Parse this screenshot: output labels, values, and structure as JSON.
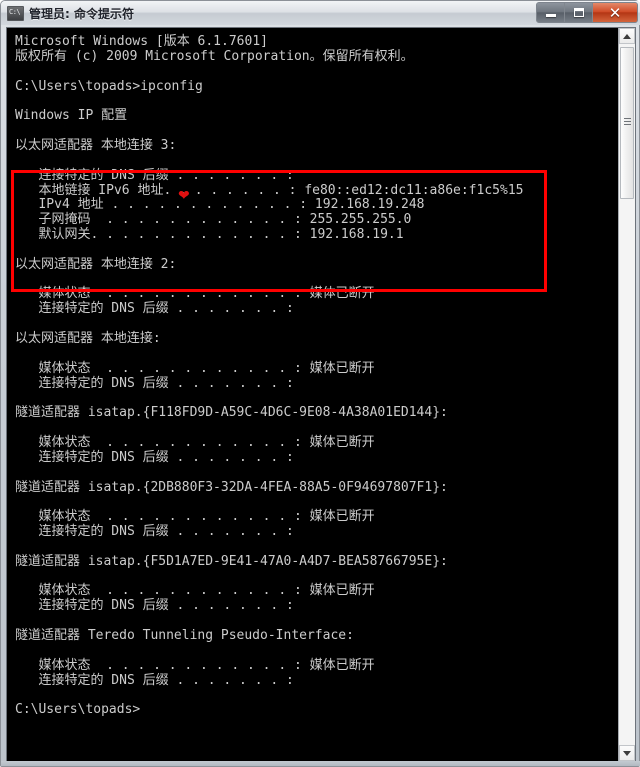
{
  "window": {
    "title": "管理员: 命令提示符",
    "icon": "cmd-console-icon",
    "buttons": {
      "minimize": "最小化",
      "maximize": "最大化",
      "close": "关闭"
    }
  },
  "colors": {
    "console_background": "#000000",
    "console_text": "#cccccc",
    "annotation_red": "#ff0000",
    "close_button": "#cf4a25",
    "titlebar": "#dde1e6"
  },
  "console": {
    "lines": [
      {
        "text": "Microsoft Windows [版本 6.1.7601]"
      },
      {
        "text": "版权所有 (c) 2009 Microsoft Corporation。保留所有权利。"
      },
      {
        "text": ""
      },
      {
        "text": "C:\\Users\\topads>ipconfig"
      },
      {
        "text": ""
      },
      {
        "text": "Windows IP 配置"
      },
      {
        "text": ""
      },
      {
        "text": "以太网适配器 本地连接 3:"
      },
      {
        "text": ""
      },
      {
        "text": "   连接特定的 DNS 后缀 . . . . . . . :"
      },
      {
        "text": "   本地链接 IPv6 地址. . . . . . . . : fe80::ed12:dc11:a86e:f1c5%15"
      },
      {
        "text": "   IPv4 地址 . . . . . . . . . . . . : 192.168.19.248"
      },
      {
        "text": "   子网掩码  . . . . . . . . . . . . : 255.255.255.0"
      },
      {
        "text": "   默认网关. . . . . . . . . . . . . : 192.168.19.1"
      },
      {
        "text": ""
      },
      {
        "text": "以太网适配器 本地连接 2:"
      },
      {
        "text": ""
      },
      {
        "text": "   媒体状态  . . . . . . . . . . . . : 媒体已断开"
      },
      {
        "text": "   连接特定的 DNS 后缀 . . . . . . . :"
      },
      {
        "text": ""
      },
      {
        "text": "以太网适配器 本地连接:"
      },
      {
        "text": ""
      },
      {
        "text": "   媒体状态  . . . . . . . . . . . . : 媒体已断开"
      },
      {
        "text": "   连接特定的 DNS 后缀 . . . . . . . :"
      },
      {
        "text": ""
      },
      {
        "text": "隧道适配器 isatap.{F118FD9D-A59C-4D6C-9E08-4A38A01ED144}:"
      },
      {
        "text": ""
      },
      {
        "text": "   媒体状态  . . . . . . . . . . . . : 媒体已断开"
      },
      {
        "text": "   连接特定的 DNS 后缀 . . . . . . . :"
      },
      {
        "text": ""
      },
      {
        "text": "隧道适配器 isatap.{2DB880F3-32DA-4FEA-88A5-0F94697807F1}:"
      },
      {
        "text": ""
      },
      {
        "text": "   媒体状态  . . . . . . . . . . . . : 媒体已断开"
      },
      {
        "text": "   连接特定的 DNS 后缀 . . . . . . . :"
      },
      {
        "text": ""
      },
      {
        "text": "隧道适配器 isatap.{F5D1A7ED-9E41-47A0-A4D7-BEA58766795E}:"
      },
      {
        "text": ""
      },
      {
        "text": "   媒体状态  . . . . . . . . . . . . : 媒体已断开"
      },
      {
        "text": "   连接特定的 DNS 后缀 . . . . . . . :"
      },
      {
        "text": ""
      },
      {
        "text": "隧道适配器 Teredo Tunneling Pseudo-Interface:"
      },
      {
        "text": ""
      },
      {
        "text": "   媒体状态  . . . . . . . . . . . . : 媒体已断开"
      },
      {
        "text": "   连接特定的 DNS 后缀 . . . . . . . :"
      },
      {
        "text": ""
      },
      {
        "text": "C:\\Users\\topads>"
      }
    ],
    "command_entered": "ipconfig",
    "prompt": "C:\\Users\\topads>"
  },
  "annotation": {
    "caret_mark": "❤",
    "highlighted_section": "以太网适配器 本地连接 3:"
  },
  "scrollbar": {
    "up_arrow": "scroll-up",
    "down_arrow": "scroll-down"
  }
}
